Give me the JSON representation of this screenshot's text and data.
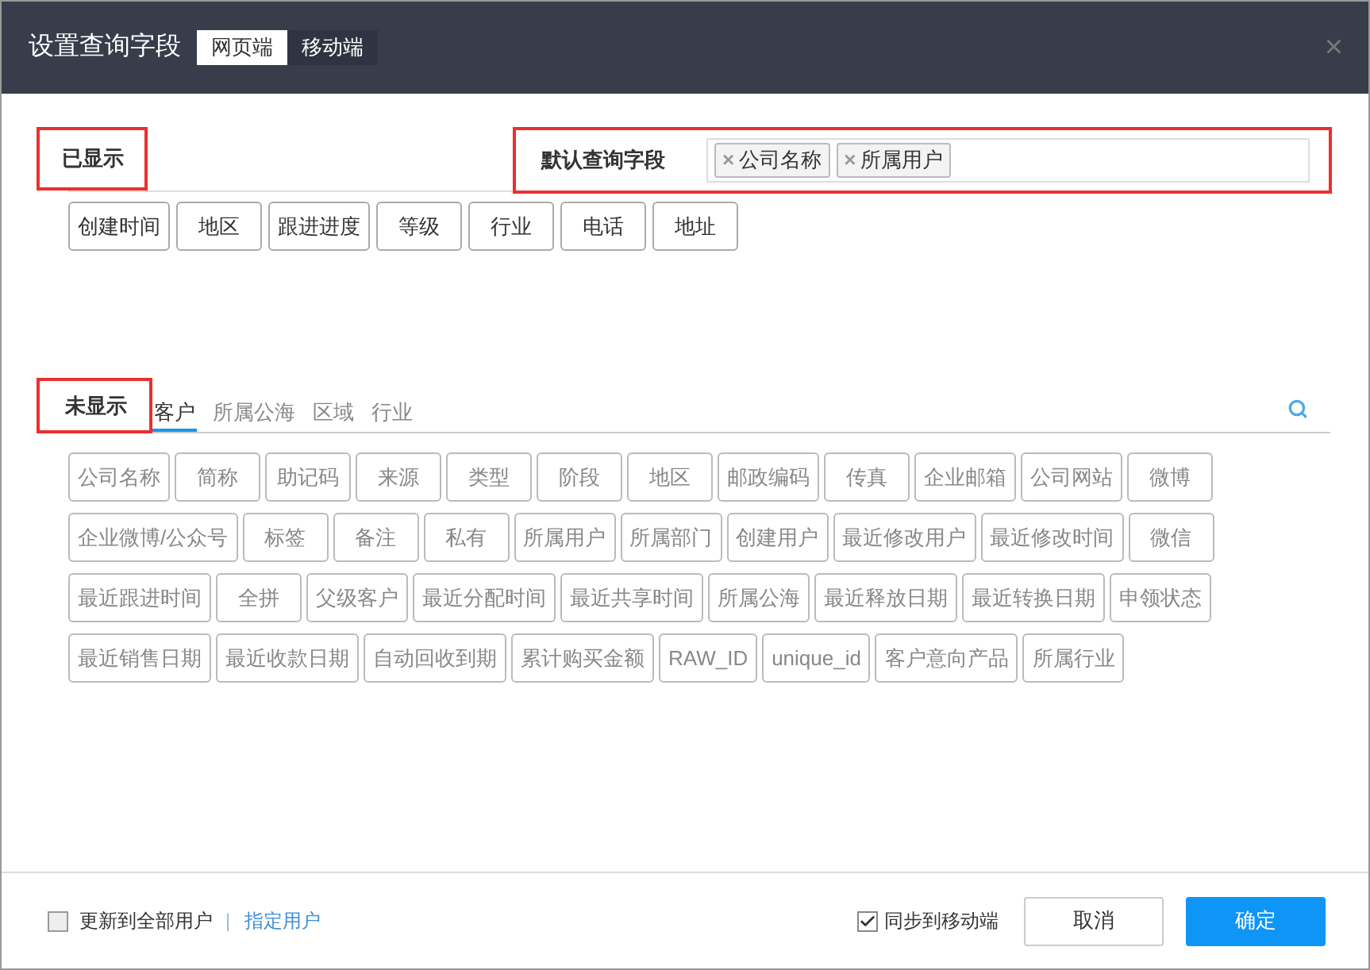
{
  "dialog": {
    "title": "设置查询字段",
    "close": "×",
    "tabs": [
      {
        "label": "网页端",
        "selected": true
      },
      {
        "label": "移动端",
        "selected": false
      }
    ]
  },
  "shown": {
    "label": "已显示",
    "highlighted": true,
    "fields": [
      "创建时间",
      "地区",
      "跟进进度",
      "等级",
      "行业",
      "电话",
      "地址"
    ]
  },
  "default_fields": {
    "label": "默认查询字段",
    "highlighted": true,
    "tags": [
      "公司名称",
      "所属用户"
    ],
    "remove": "×"
  },
  "hidden": {
    "label": "未显示",
    "highlighted": true,
    "tabs": [
      {
        "label": "客户",
        "selected": true
      },
      {
        "label": "所属公海",
        "selected": false
      },
      {
        "label": "区域",
        "selected": false
      },
      {
        "label": "行业",
        "selected": false
      }
    ],
    "fields": [
      "公司名称",
      "简称",
      "助记码",
      "来源",
      "类型",
      "阶段",
      "地区",
      "邮政编码",
      "传真",
      "企业邮箱",
      "公司网站",
      "微博",
      "企业微博/公众号",
      "标签",
      "备注",
      "私有",
      "所属用户",
      "所属部门",
      "创建用户",
      "最近修改用户",
      "最近修改时间",
      "微信",
      "最近跟进时间",
      "全拼",
      "父级客户",
      "最近分配时间",
      "最近共享时间",
      "所属公海",
      "最近释放日期",
      "最近转换日期",
      "申领状态",
      "最近销售日期",
      "最近收款日期",
      "自动回收到期",
      "累计购买金额",
      "RAW_ID",
      "unique_id",
      "客户意向产品",
      "所属行业"
    ]
  },
  "footer": {
    "update_all": {
      "label": "更新到全部用户",
      "checked": false
    },
    "separator": "|",
    "assign_link": "指定用户",
    "sync_mobile": {
      "label": "同步到移动端",
      "checked": true
    },
    "buttons": [
      {
        "label": "取消",
        "kind": "secondary"
      },
      {
        "label": "确定",
        "kind": "primary"
      }
    ]
  }
}
